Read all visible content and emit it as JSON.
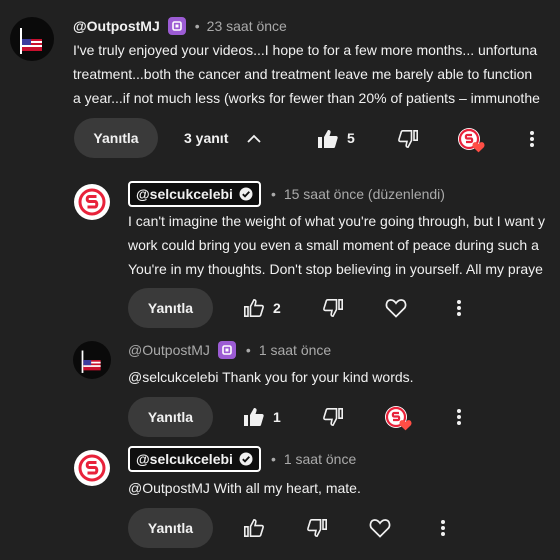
{
  "thread": {
    "top_comment": {
      "author": "@OutpostMJ",
      "time": "23 saat önce",
      "lines": [
        "I've truly enjoyed your videos...I hope to for a few more months... unfortuna",
        "treatment...both the cancer and treatment leave me barely able to function",
        "a year...if not much less (works for fewer than 20% of patients – immunothe"
      ],
      "reply_label": "Yanıtla",
      "replies_toggle": "3 yanıt",
      "likes": "5"
    },
    "replies": [
      {
        "author": "@selcukcelebi",
        "time": "15 saat önce (düzenlendi)",
        "lines": [
          "I can't imagine the weight of what you're going through, but I want y",
          "work could bring you even a small moment of peace during such a",
          "You're in my thoughts. Don't stop believing in yourself. All my praye"
        ],
        "reply_label": "Yanıtla",
        "likes": "2"
      },
      {
        "author": "@OutpostMJ",
        "time": "1 saat önce",
        "lines": [
          "@selcukcelebi  Thank you for your kind words."
        ],
        "reply_label": "Yanıtla",
        "likes": "1"
      },
      {
        "author": "@selcukcelebi",
        "time": "1 saat önce",
        "lines": [
          "@OutpostMJ With all my heart, mate."
        ],
        "reply_label": "Yanıtla",
        "likes": ""
      }
    ],
    "separator": "•"
  },
  "colors": {
    "background": "#212121",
    "heart_red": "#ff4e45",
    "badge_purple": "#9c5cd4",
    "brand_red": "#e8223a"
  }
}
